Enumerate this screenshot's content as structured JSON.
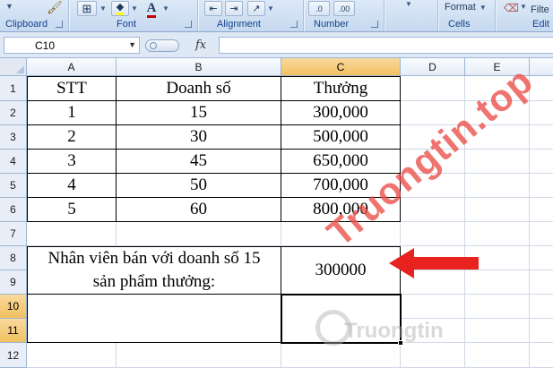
{
  "ribbon": {
    "groups": {
      "clipboard": "Clipboard",
      "font": "Font",
      "alignment": "Alignment",
      "number": "Number",
      "cells": "Cells",
      "editing": "Edit"
    },
    "format_button": "Format",
    "filter_button": "Filte",
    "number_format_1": ".0",
    "number_format_2": ".00",
    "number_format_3": "00",
    "number_format_4": "→.0",
    "font_color_letter": "A",
    "accent": "#c00000"
  },
  "formula_bar": {
    "name_box": "C10",
    "fx_label": "fx",
    "formula": ""
  },
  "grid": {
    "columns": [
      "A",
      "B",
      "C",
      "D",
      "E"
    ],
    "rows": [
      "1",
      "2",
      "3",
      "4",
      "5",
      "6",
      "7",
      "8",
      "9",
      "10",
      "11",
      "12"
    ],
    "selected_column": "C",
    "selected_rows": [
      "10",
      "11"
    ],
    "table": {
      "headers": [
        "STT",
        "Doanh số",
        "Thưởng"
      ],
      "rows": [
        [
          "1",
          "15",
          "300,000"
        ],
        [
          "2",
          "30",
          "500,000"
        ],
        [
          "3",
          "45",
          "650,000"
        ],
        [
          "4",
          "50",
          "700,000"
        ],
        [
          "5",
          "60",
          "800,000"
        ]
      ]
    },
    "question_line1": "Nhân viên bán với doanh số 15",
    "question_line2": "sản phẩm thưởng:",
    "result": "300000"
  },
  "watermark": {
    "text": "Truongtin.top",
    "sub": "Truongtin"
  },
  "colors": {
    "arrow": "#e8231f",
    "selected_header": "#f3c766"
  }
}
